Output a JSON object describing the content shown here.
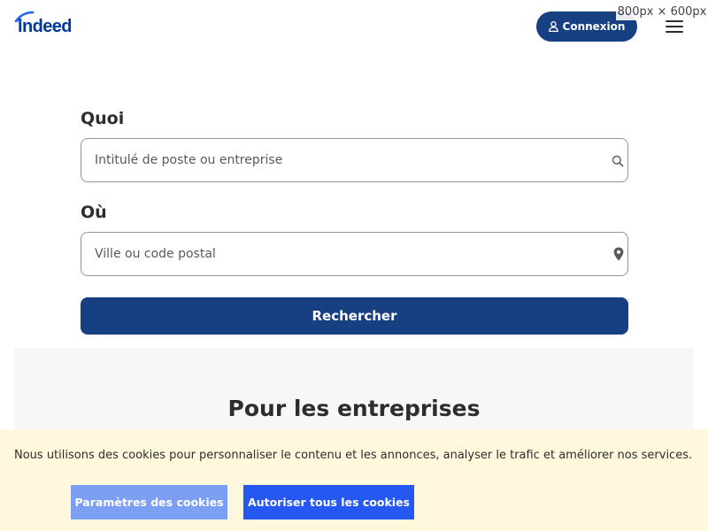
{
  "header": {
    "logo_text": "indeed",
    "login_label": "Connexion",
    "user_icon": "user-icon",
    "menu_icon": "hamburger-menu-icon",
    "dims_label": "800px × 600px"
  },
  "search": {
    "what_label": "Quoi",
    "what_placeholder": "Intitulé de poste ou entreprise",
    "what_icon": "search-icon",
    "where_label": "Où",
    "where_placeholder": "Ville ou code postal",
    "where_icon": "location-pin-icon",
    "button_label": "Rechercher"
  },
  "employers": {
    "title": "Pour les entreprises"
  },
  "cookies": {
    "text": "Nous utilisons des cookies pour personnaliser le contenu et les annonces, analyser le trafic et améliorer nos services.",
    "settings_label": "Paramètres des cookies",
    "accept_label": "Autoriser tous les cookies"
  },
  "colors": {
    "brand": "#164081",
    "logo_blue": "#2164f3",
    "cookie_bg": "#fff8dc",
    "cookie_settings": "#7c9ff3",
    "cookie_accept": "#2557f2",
    "band_bg": "#f8f7f5"
  }
}
